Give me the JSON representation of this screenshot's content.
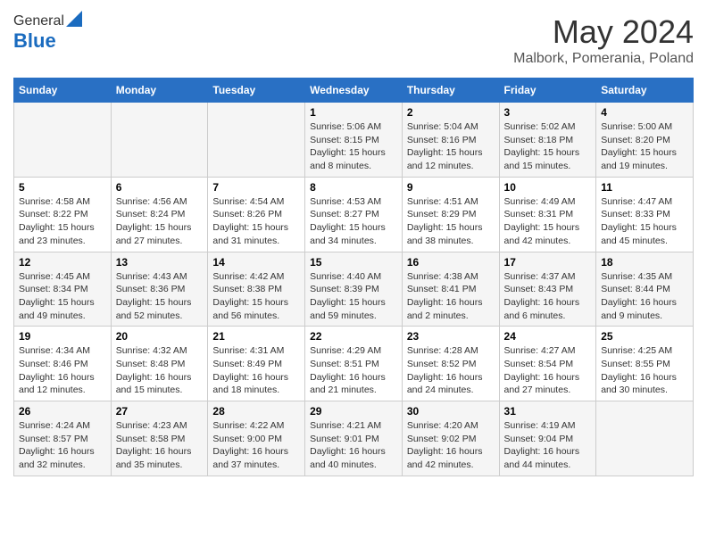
{
  "header": {
    "logo_line1": "General",
    "logo_line2": "Blue",
    "month": "May 2024",
    "location": "Malbork, Pomerania, Poland"
  },
  "days_of_week": [
    "Sunday",
    "Monday",
    "Tuesday",
    "Wednesday",
    "Thursday",
    "Friday",
    "Saturday"
  ],
  "weeks": [
    [
      {
        "num": "",
        "info": ""
      },
      {
        "num": "",
        "info": ""
      },
      {
        "num": "",
        "info": ""
      },
      {
        "num": "1",
        "info": "Sunrise: 5:06 AM\nSunset: 8:15 PM\nDaylight: 15 hours\nand 8 minutes."
      },
      {
        "num": "2",
        "info": "Sunrise: 5:04 AM\nSunset: 8:16 PM\nDaylight: 15 hours\nand 12 minutes."
      },
      {
        "num": "3",
        "info": "Sunrise: 5:02 AM\nSunset: 8:18 PM\nDaylight: 15 hours\nand 15 minutes."
      },
      {
        "num": "4",
        "info": "Sunrise: 5:00 AM\nSunset: 8:20 PM\nDaylight: 15 hours\nand 19 minutes."
      }
    ],
    [
      {
        "num": "5",
        "info": "Sunrise: 4:58 AM\nSunset: 8:22 PM\nDaylight: 15 hours\nand 23 minutes."
      },
      {
        "num": "6",
        "info": "Sunrise: 4:56 AM\nSunset: 8:24 PM\nDaylight: 15 hours\nand 27 minutes."
      },
      {
        "num": "7",
        "info": "Sunrise: 4:54 AM\nSunset: 8:26 PM\nDaylight: 15 hours\nand 31 minutes."
      },
      {
        "num": "8",
        "info": "Sunrise: 4:53 AM\nSunset: 8:27 PM\nDaylight: 15 hours\nand 34 minutes."
      },
      {
        "num": "9",
        "info": "Sunrise: 4:51 AM\nSunset: 8:29 PM\nDaylight: 15 hours\nand 38 minutes."
      },
      {
        "num": "10",
        "info": "Sunrise: 4:49 AM\nSunset: 8:31 PM\nDaylight: 15 hours\nand 42 minutes."
      },
      {
        "num": "11",
        "info": "Sunrise: 4:47 AM\nSunset: 8:33 PM\nDaylight: 15 hours\nand 45 minutes."
      }
    ],
    [
      {
        "num": "12",
        "info": "Sunrise: 4:45 AM\nSunset: 8:34 PM\nDaylight: 15 hours\nand 49 minutes."
      },
      {
        "num": "13",
        "info": "Sunrise: 4:43 AM\nSunset: 8:36 PM\nDaylight: 15 hours\nand 52 minutes."
      },
      {
        "num": "14",
        "info": "Sunrise: 4:42 AM\nSunset: 8:38 PM\nDaylight: 15 hours\nand 56 minutes."
      },
      {
        "num": "15",
        "info": "Sunrise: 4:40 AM\nSunset: 8:39 PM\nDaylight: 15 hours\nand 59 minutes."
      },
      {
        "num": "16",
        "info": "Sunrise: 4:38 AM\nSunset: 8:41 PM\nDaylight: 16 hours\nand 2 minutes."
      },
      {
        "num": "17",
        "info": "Sunrise: 4:37 AM\nSunset: 8:43 PM\nDaylight: 16 hours\nand 6 minutes."
      },
      {
        "num": "18",
        "info": "Sunrise: 4:35 AM\nSunset: 8:44 PM\nDaylight: 16 hours\nand 9 minutes."
      }
    ],
    [
      {
        "num": "19",
        "info": "Sunrise: 4:34 AM\nSunset: 8:46 PM\nDaylight: 16 hours\nand 12 minutes."
      },
      {
        "num": "20",
        "info": "Sunrise: 4:32 AM\nSunset: 8:48 PM\nDaylight: 16 hours\nand 15 minutes."
      },
      {
        "num": "21",
        "info": "Sunrise: 4:31 AM\nSunset: 8:49 PM\nDaylight: 16 hours\nand 18 minutes."
      },
      {
        "num": "22",
        "info": "Sunrise: 4:29 AM\nSunset: 8:51 PM\nDaylight: 16 hours\nand 21 minutes."
      },
      {
        "num": "23",
        "info": "Sunrise: 4:28 AM\nSunset: 8:52 PM\nDaylight: 16 hours\nand 24 minutes."
      },
      {
        "num": "24",
        "info": "Sunrise: 4:27 AM\nSunset: 8:54 PM\nDaylight: 16 hours\nand 27 minutes."
      },
      {
        "num": "25",
        "info": "Sunrise: 4:25 AM\nSunset: 8:55 PM\nDaylight: 16 hours\nand 30 minutes."
      }
    ],
    [
      {
        "num": "26",
        "info": "Sunrise: 4:24 AM\nSunset: 8:57 PM\nDaylight: 16 hours\nand 32 minutes."
      },
      {
        "num": "27",
        "info": "Sunrise: 4:23 AM\nSunset: 8:58 PM\nDaylight: 16 hours\nand 35 minutes."
      },
      {
        "num": "28",
        "info": "Sunrise: 4:22 AM\nSunset: 9:00 PM\nDaylight: 16 hours\nand 37 minutes."
      },
      {
        "num": "29",
        "info": "Sunrise: 4:21 AM\nSunset: 9:01 PM\nDaylight: 16 hours\nand 40 minutes."
      },
      {
        "num": "30",
        "info": "Sunrise: 4:20 AM\nSunset: 9:02 PM\nDaylight: 16 hours\nand 42 minutes."
      },
      {
        "num": "31",
        "info": "Sunrise: 4:19 AM\nSunset: 9:04 PM\nDaylight: 16 hours\nand 44 minutes."
      },
      {
        "num": "",
        "info": ""
      }
    ]
  ]
}
